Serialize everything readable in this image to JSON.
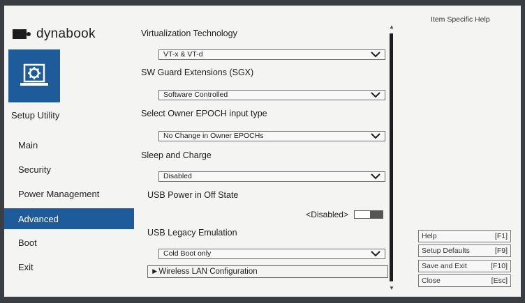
{
  "brand": {
    "name": "dynabook"
  },
  "sidebar": {
    "title": "Setup Utility",
    "items": [
      {
        "label": "Main"
      },
      {
        "label": "Security"
      },
      {
        "label": "Power Management"
      },
      {
        "label": "Advanced",
        "active": true
      },
      {
        "label": "Boot"
      },
      {
        "label": "Exit"
      }
    ]
  },
  "settings": [
    {
      "label": "Virtualization Technology",
      "value": "VT-x & VT-d"
    },
    {
      "label": "SW Guard Extensions (SGX)",
      "value": "Software Controlled"
    },
    {
      "label": "Select Owner EPOCH input type",
      "value": "No Change in Owner EPOCHs"
    },
    {
      "label": "Sleep and Charge",
      "value": "Disabled"
    },
    {
      "label": "USB Power in Off State",
      "value": "<Disabled>"
    },
    {
      "label": "USB Legacy Emulation",
      "value": "Cold Boot only"
    }
  ],
  "submenu": {
    "label": "►Wireless LAN Configuration"
  },
  "help": {
    "title": "Item Specific Help",
    "keys": [
      {
        "label": "Help",
        "key": "[F1]"
      },
      {
        "label": "Setup Defaults",
        "key": "[F9]"
      },
      {
        "label": "Save and Exit",
        "key": "[F10]"
      },
      {
        "label": "Close",
        "key": "[Esc]"
      }
    ]
  },
  "colors": {
    "accent": "#1e5b9a",
    "background": "#f4f4f2"
  },
  "icons": {
    "setup": "gear-laptop-icon",
    "dropdown": "chevron-down-icon"
  }
}
